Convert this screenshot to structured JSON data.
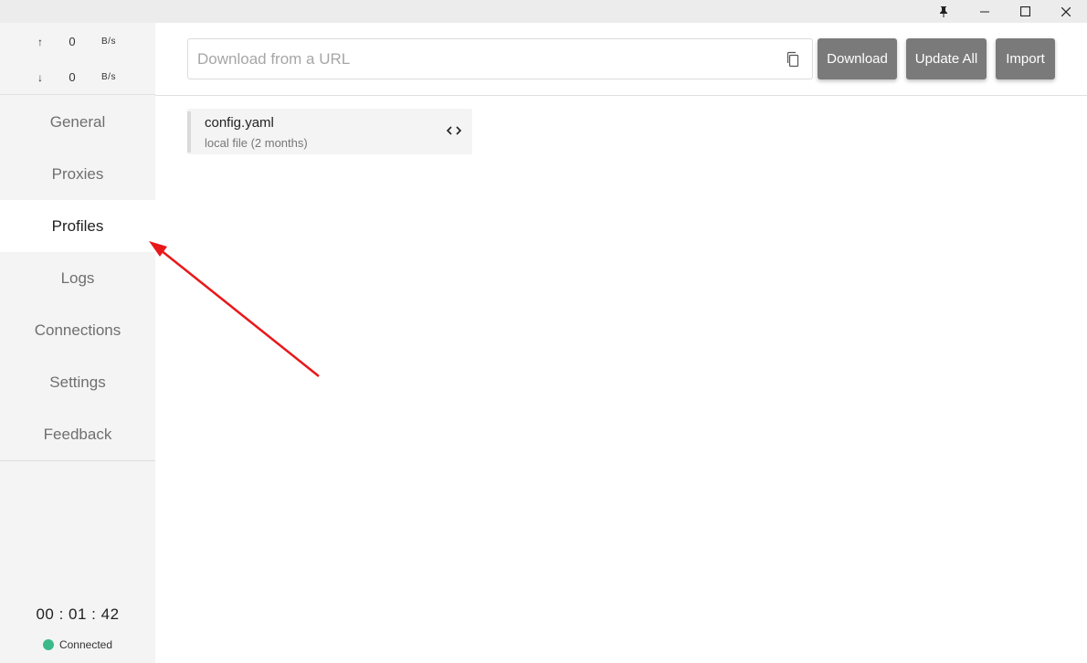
{
  "titlebar": {
    "pin_icon": "pin-icon",
    "minimize_icon": "minimize-icon",
    "maximize_icon": "maximize-icon",
    "close_icon": "close-icon"
  },
  "traffic": {
    "upload": {
      "arrow": "↑",
      "value": "0",
      "unit": "B/s"
    },
    "download": {
      "arrow": "↓",
      "value": "0",
      "unit": "B/s"
    }
  },
  "nav": {
    "items": [
      {
        "label": "General"
      },
      {
        "label": "Proxies"
      },
      {
        "label": "Profiles",
        "active": true
      },
      {
        "label": "Logs"
      },
      {
        "label": "Connections"
      },
      {
        "label": "Settings"
      },
      {
        "label": "Feedback"
      }
    ]
  },
  "footer": {
    "timer": "00 : 01 : 42",
    "status": "Connected",
    "status_color": "#3cb98a"
  },
  "header": {
    "url_placeholder": "Download from a URL",
    "url_value": "",
    "paste_icon": "paste-icon",
    "download_label": "Download",
    "update_all_label": "Update All",
    "import_label": "Import",
    "button_color": "#7a7a7a"
  },
  "profiles": [
    {
      "name": "config.yaml",
      "subtitle": "local file (2 months)",
      "icon": "code-icon"
    }
  ],
  "annotation": {
    "color": "#e8181a",
    "icon": "red-arrow"
  }
}
